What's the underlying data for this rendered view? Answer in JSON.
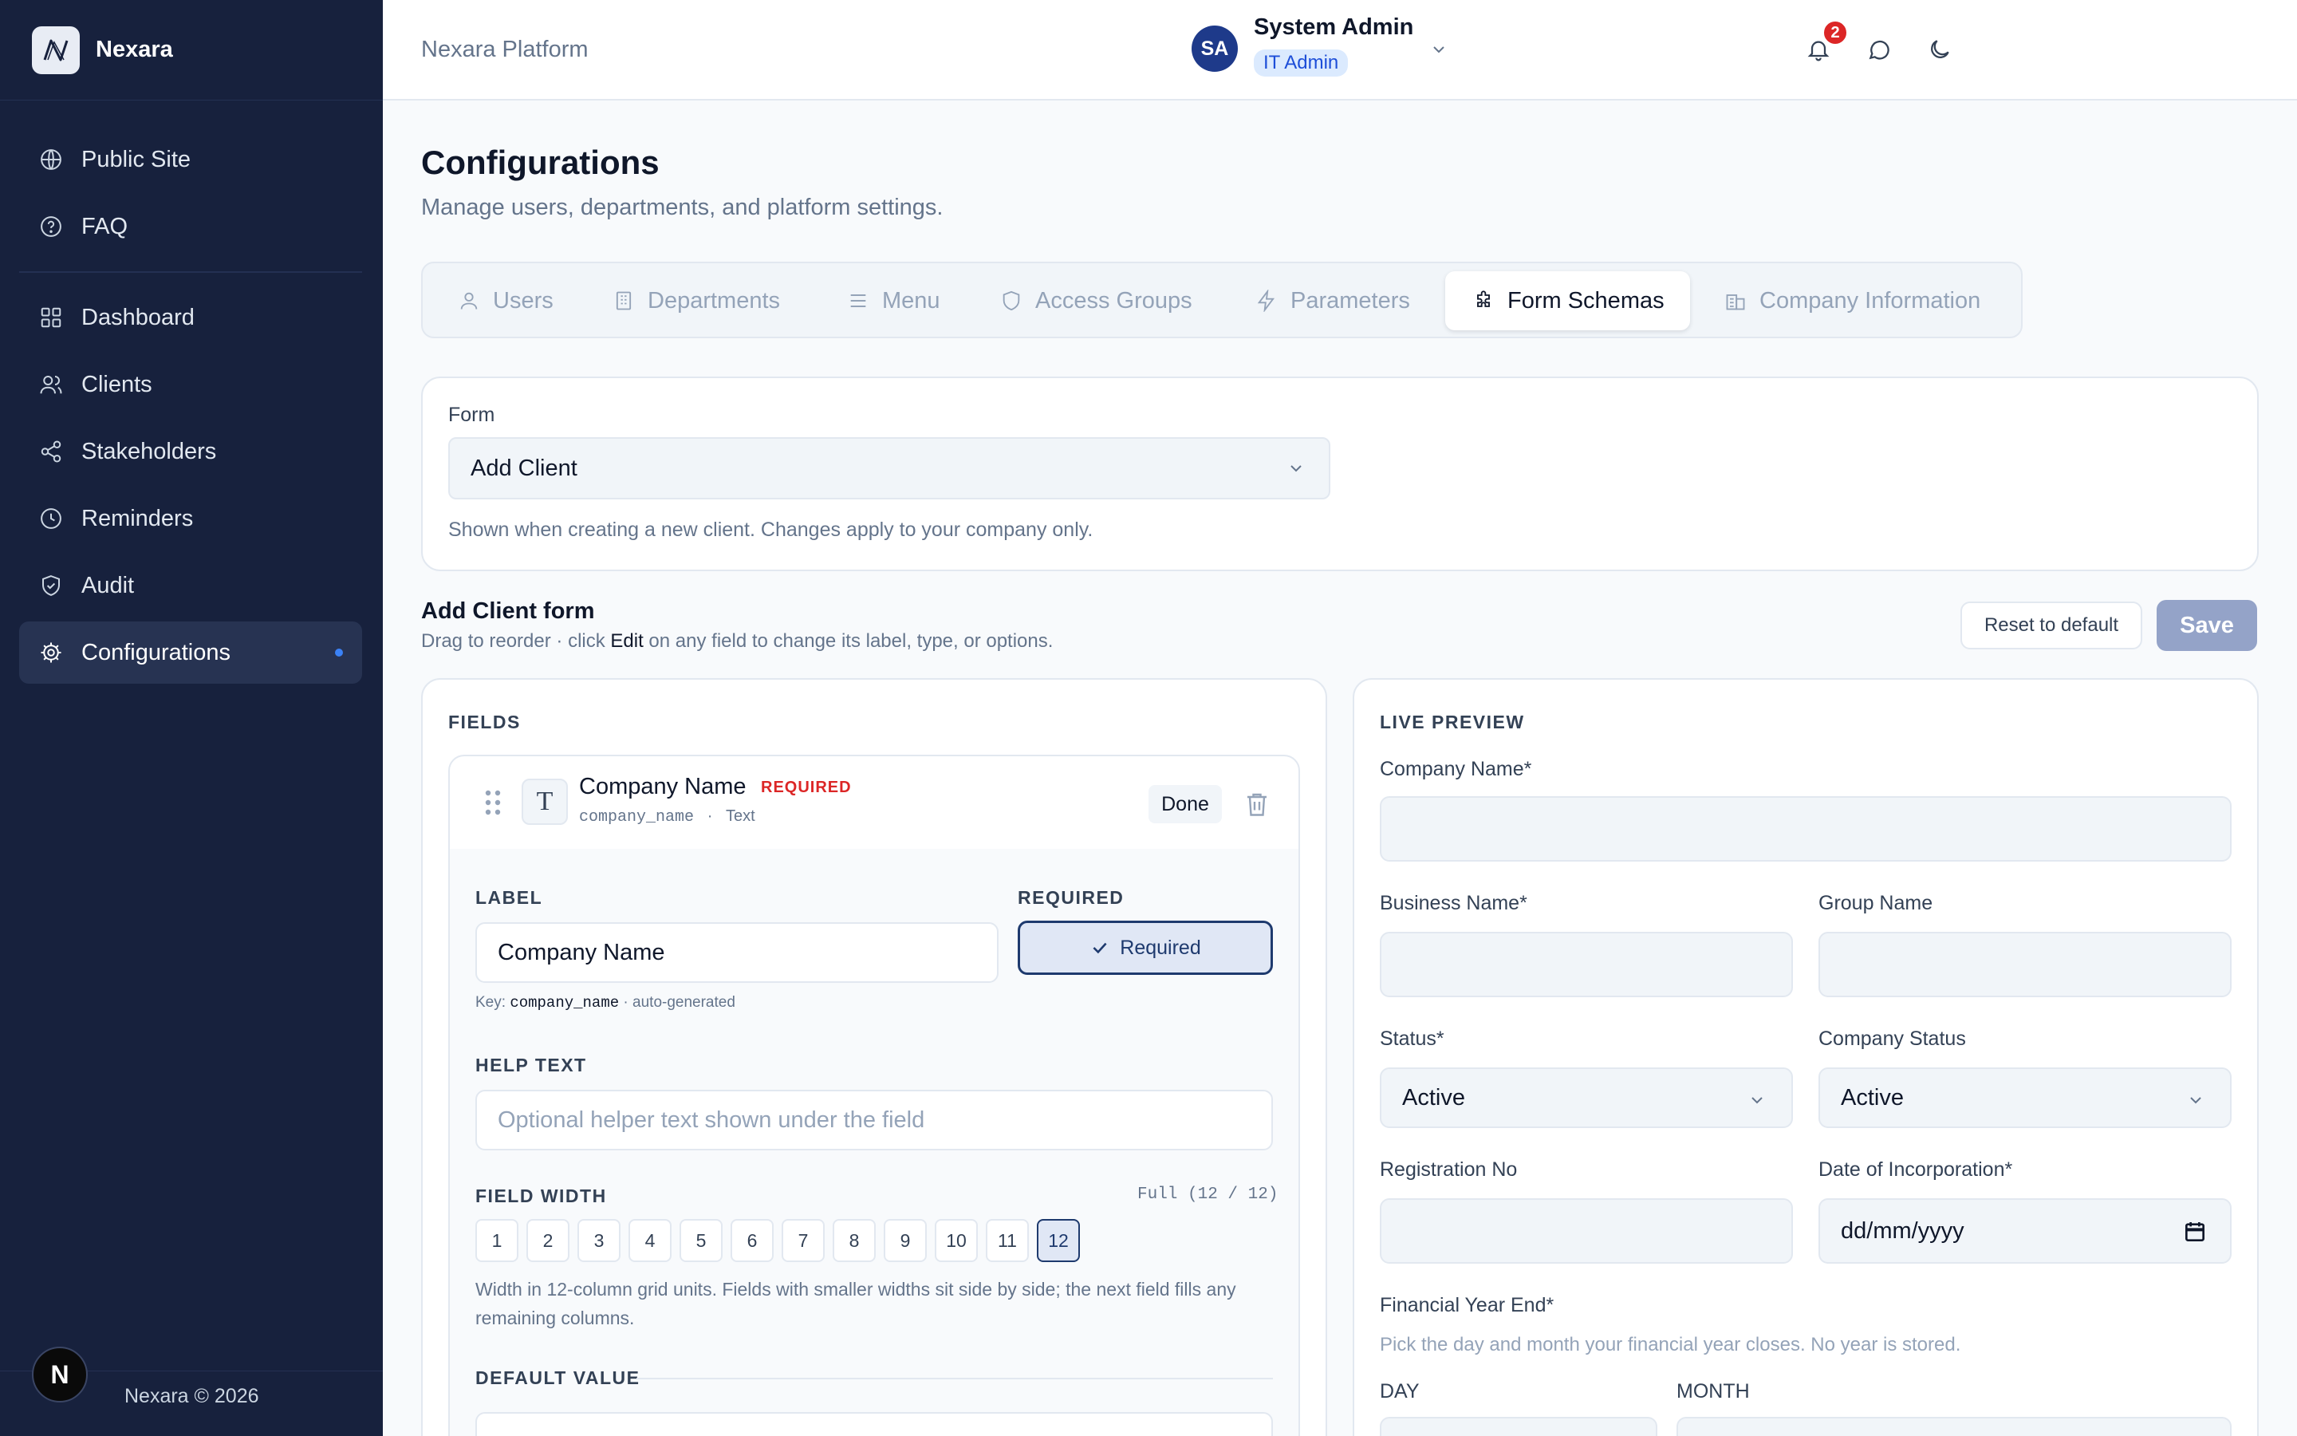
{
  "app": {
    "name": "Nexara",
    "platform": "Nexara Platform",
    "copyright": "Nexara © 2026",
    "footer_avatar_letter": "N"
  },
  "sidebar": {
    "items": [
      {
        "label": "Public Site",
        "icon": "globe-icon"
      },
      {
        "label": "FAQ",
        "icon": "help-circle-icon"
      },
      {
        "label": "Dashboard",
        "icon": "grid-icon"
      },
      {
        "label": "Clients",
        "icon": "users-icon"
      },
      {
        "label": "Stakeholders",
        "icon": "share-icon"
      },
      {
        "label": "Reminders",
        "icon": "clock-icon"
      },
      {
        "label": "Audit",
        "icon": "shield-check-icon"
      },
      {
        "label": "Configurations",
        "icon": "gear-icon",
        "active": true
      }
    ]
  },
  "header": {
    "notifications_count": "2",
    "user": {
      "initials": "SA",
      "name": "System Admin",
      "role": "IT Admin"
    }
  },
  "page": {
    "title": "Configurations",
    "subtitle": "Manage users, departments, and platform settings."
  },
  "tabs": [
    {
      "label": "Users",
      "icon": "user-icon"
    },
    {
      "label": "Departments",
      "icon": "building-icon"
    },
    {
      "label": "Menu",
      "icon": "menu-icon"
    },
    {
      "label": "Access Groups",
      "icon": "shield-icon"
    },
    {
      "label": "Parameters",
      "icon": "bolt-icon"
    },
    {
      "label": "Form Schemas",
      "icon": "puzzle-icon",
      "active": true
    },
    {
      "label": "Company Information",
      "icon": "office-icon"
    }
  ],
  "form_select": {
    "label": "Form",
    "value": "Add Client",
    "hint": "Shown when creating a new client. Changes apply to your company only."
  },
  "section": {
    "title": "Add Client form",
    "subtitle_pre": "Drag to reorder · click ",
    "subtitle_edit": "Edit",
    "subtitle_post": " on any field to change its label, type, or options.",
    "reset_label": "Reset to default",
    "save_label": "Save"
  },
  "fields_panel": {
    "title": "FIELDS",
    "field": {
      "type_glyph": "T",
      "name": "Company Name",
      "required_badge": "REQUIRED",
      "key": "company_name",
      "sep": "·",
      "type": "Text",
      "done_label": "Done"
    },
    "editor": {
      "label_heading": "LABEL",
      "label_value": "Company Name",
      "required_heading": "REQUIRED",
      "required_toggle": "Required",
      "key_prefix": "Key: ",
      "key_value": "company_name",
      "key_suffix": " · auto-generated",
      "help_heading": "HELP TEXT",
      "help_placeholder": "Optional helper text shown under the field",
      "width_heading": "FIELD WIDTH",
      "width_value": "Full (12 / 12)",
      "width_options": [
        "1",
        "2",
        "3",
        "4",
        "5",
        "6",
        "7",
        "8",
        "9",
        "10",
        "11",
        "12"
      ],
      "width_selected": 12,
      "width_hint": "Width in 12-column grid units. Fields with smaller widths sit side by side; the next field fills any remaining columns.",
      "default_heading": "DEFAULT VALUE"
    }
  },
  "preview": {
    "title": "LIVE PREVIEW",
    "company_name": "Company Name*",
    "business_name": "Business Name*",
    "group_name": "Group Name",
    "status": "Status*",
    "status_value": "Active",
    "company_status": "Company Status",
    "company_status_value": "Active",
    "registration_no": "Registration No",
    "date_of_incorporation": "Date of Incorporation*",
    "date_placeholder": "dd/mm/yyyy",
    "financial_year_end": "Financial Year End*",
    "fye_hint": "Pick the day and month your financial year closes. No year is stored.",
    "day": "DAY",
    "month": "MONTH"
  },
  "colors": {
    "sidebar_bg": "#17213d",
    "accent": "#1e3a6e",
    "danger": "#dc2626",
    "save_disabled": "#94a3c8"
  }
}
